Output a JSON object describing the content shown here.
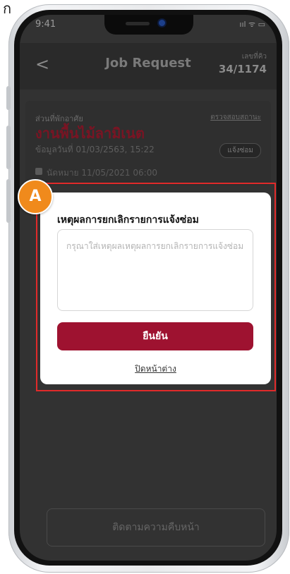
{
  "corner_text": "ก",
  "status": {
    "time": "9:41",
    "icons": "ııl ᯤ ▭"
  },
  "header": {
    "back": "<",
    "title": "Job Request",
    "counter_label": "เลขที่คิว",
    "counter_value": "34/1174"
  },
  "job": {
    "area_label": "ส่วนที่พักอาศัย",
    "check_link": "ตรวจสอบสถานะ",
    "title": "งานพื้นไม้ลามิเนต",
    "date": "ข้อมูลวันที่ 01/03/2563, 15:22",
    "badge": "แจ้งซ่อม",
    "due": "นัดหมาย 11/05/2021 06:00"
  },
  "annotation": {
    "label": "A",
    "color": "#f08a1c",
    "highlight_color": "#e02a2a"
  },
  "modal": {
    "title": "เหตุผลการยกเลิกรายการแจ้งซ่อม",
    "placeholder": "กรุณาใส่เหตุผลเหตุผลการยกเลิกรายการแจ้งซ่อม",
    "confirm_label": "ยืนยัน",
    "close_label": "ปิดหน้าต่าง",
    "accent": "#9e1230"
  },
  "footer": {
    "track_label": "ติดตามความคืบหน้า"
  }
}
